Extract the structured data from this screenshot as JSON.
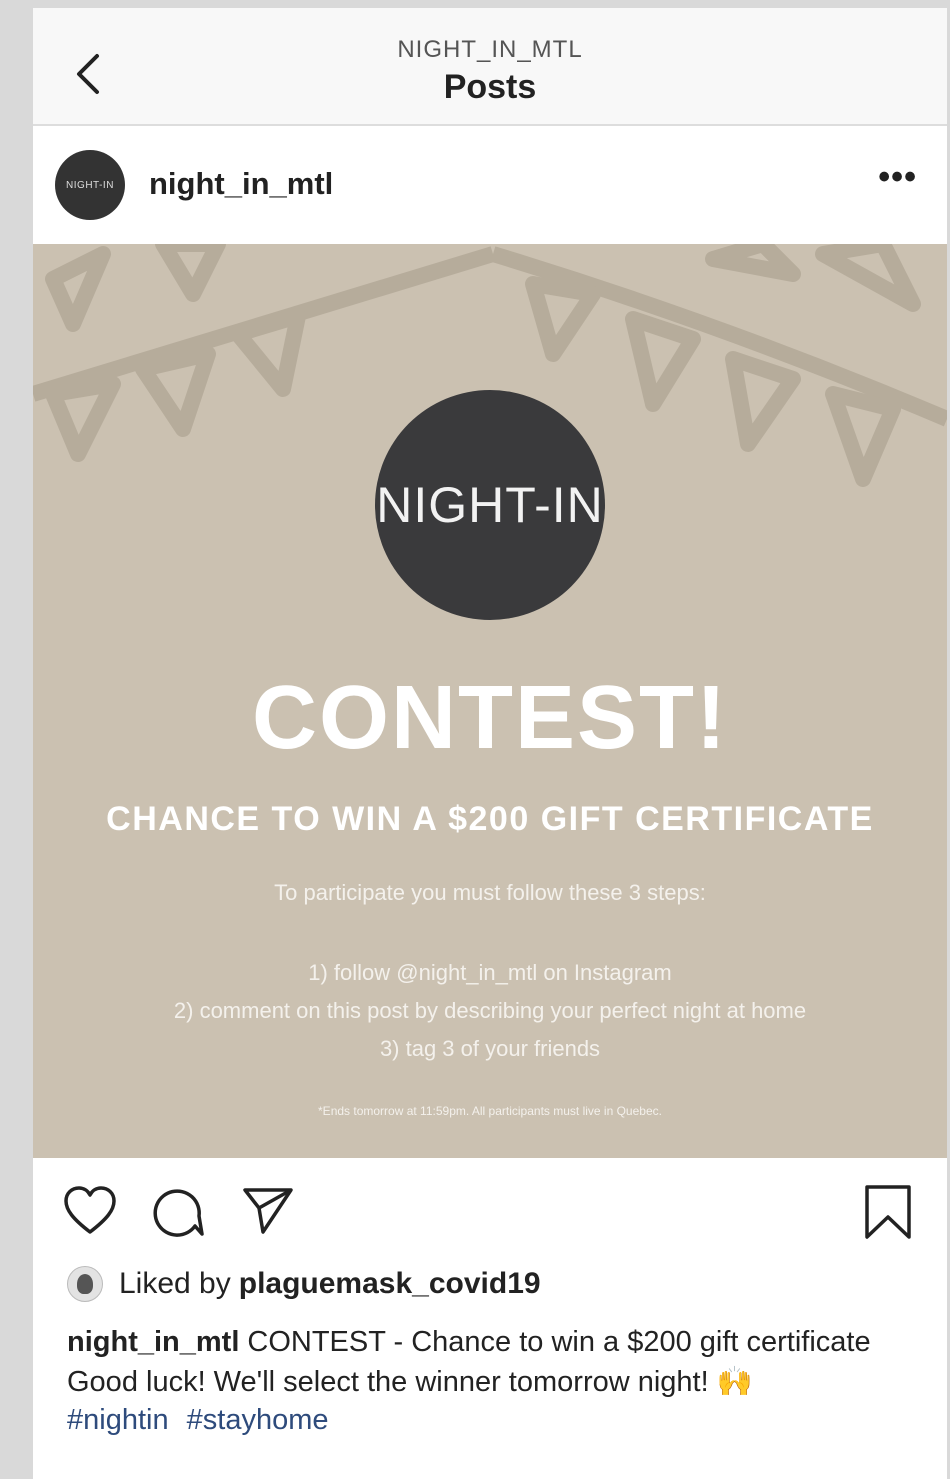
{
  "header": {
    "account": "NIGHT_IN_MTL",
    "title": "Posts",
    "back_icon": "chevron-left-icon"
  },
  "post": {
    "avatar_text": "NIGHT-IN",
    "username": "night_in_mtl",
    "more_icon": "ellipsis-icon",
    "image": {
      "logo_text": "NIGHT-IN",
      "headline": "CONTEST!",
      "subheadline": "CHANCE TO WIN A $200 GIFT CERTIFICATE",
      "steps_intro": "To participate you must follow these 3 steps:",
      "steps": [
        "1) follow @night_in_mtl on Instagram",
        "2) comment on this post by describing your perfect night at home",
        "3) tag 3 of your friends"
      ],
      "fineprint": "*Ends tomorrow at 11:59pm. All participants must live in Quebec.",
      "background_color": "#cbc1b1",
      "logo_color": "#3a3a3c"
    },
    "actions": {
      "like_icon": "heart-icon",
      "comment_icon": "comment-icon",
      "share_icon": "send-icon",
      "save_icon": "bookmark-icon"
    },
    "likes": {
      "prefix": "Liked by",
      "user": "plaguemask_covid19"
    },
    "caption": {
      "user": "night_in_mtl",
      "text": "CONTEST - Chance to win a $200 gift certificate",
      "line2": "Good luck! We'll select the winner tomorrow night! 🙌",
      "hashtags": [
        "#nightin",
        "#stayhome"
      ]
    }
  },
  "colors": {
    "hashtag": "#2e4b7c",
    "page_bg": "#d9d9d9"
  }
}
